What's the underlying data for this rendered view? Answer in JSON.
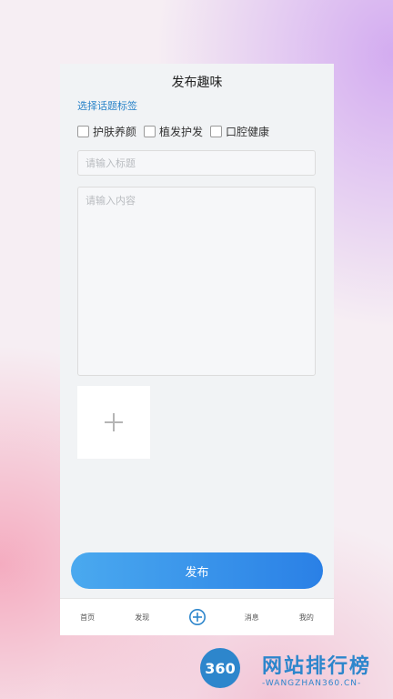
{
  "page": {
    "title": "发布趣味"
  },
  "topic": {
    "label": "选择话题标签",
    "tags": [
      {
        "label": "护肤养颜",
        "checked": false
      },
      {
        "label": "植发护发",
        "checked": false
      },
      {
        "label": "口腔健康",
        "checked": false
      }
    ]
  },
  "form": {
    "title_placeholder": "请输入标题",
    "title_value": "",
    "content_placeholder": "请输入内容",
    "content_value": "",
    "add_image_icon": "plus-icon"
  },
  "publish_label": "发布",
  "tabbar": {
    "items": [
      {
        "label": "首页"
      },
      {
        "label": "发现"
      },
      {
        "icon": "circle-plus-icon"
      },
      {
        "label": "消息"
      },
      {
        "label": "我的"
      }
    ]
  },
  "watermark": {
    "logo": "360",
    "title": "网站排行榜",
    "subtitle": "-WANGZHAN360.CN-"
  },
  "colors": {
    "accent": "#2b84c9",
    "publish_gradient_start": "#4aa9ef",
    "publish_gradient_end": "#2a80e6",
    "panel_background": "#f1f3f5"
  }
}
